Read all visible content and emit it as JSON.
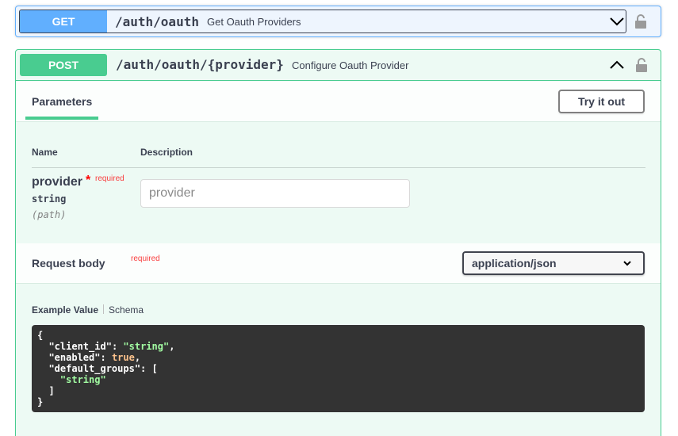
{
  "get_op": {
    "method": "GET",
    "path": "/auth/oauth",
    "description": "Get Oauth Providers",
    "color": "#61affe",
    "chevron_icon": "chevron-down-icon",
    "lock_icon": "lock-icon"
  },
  "post_op": {
    "method": "POST",
    "path": "/auth/oauth/{provider}",
    "description": "Configure Oauth Provider",
    "color": "#49cc90",
    "chevron_icon": "chevron-up-icon",
    "lock_icon": "lock-icon",
    "parameters_tab": "Parameters",
    "try_it_out_label": "Try it out",
    "columns": {
      "name": "Name",
      "description": "Description"
    },
    "param": {
      "name": "provider",
      "required_star": "*",
      "required_label": "required",
      "type": "string",
      "in": "(path)",
      "placeholder": "provider"
    },
    "request_body": {
      "title": "Request body",
      "required_label": "required",
      "content_type": "application/json"
    },
    "example": {
      "value_tab": "Example Value",
      "schema_tab": "Schema",
      "code": {
        "open": "{",
        "k1": "\"client_id\"",
        "v1": "\"string\"",
        "k2": "\"enabled\"",
        "v2": "true",
        "k3": "\"default_groups\"",
        "arr_open": "[",
        "v3": "\"string\"",
        "arr_close": "]",
        "close": "}"
      }
    }
  }
}
